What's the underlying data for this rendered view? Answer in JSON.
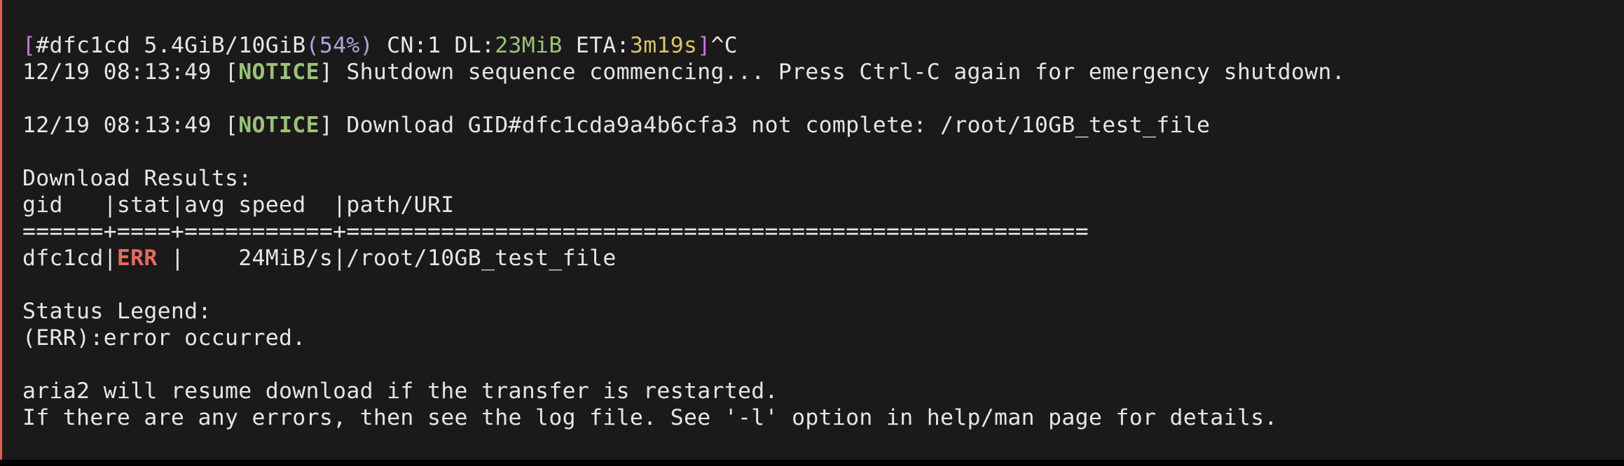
{
  "progress": {
    "open": "[",
    "gid_progress": "#dfc1cd 5.4GiB/10GiB",
    "percent": "(54%)",
    "cn": " CN:1 DL:",
    "dl": "23MiB",
    "eta_label": " ETA:",
    "eta": "3m19s",
    "close": "]",
    "interrupt": "^C"
  },
  "notice1": {
    "timestamp": "12/19 08:13:49 ",
    "open": "[",
    "tag": "NOTICE",
    "close": "]",
    "message": " Shutdown sequence commencing... Press Ctrl-C again for emergency shutdown."
  },
  "notice2": {
    "timestamp": "12/19 08:13:49 ",
    "open": "[",
    "tag": "NOTICE",
    "close": "]",
    "message": " Download GID#dfc1cda9a4b6cfa3 not complete: /root/10GB_test_file"
  },
  "results": {
    "title": "Download Results:",
    "header": "gid   |stat|avg speed  |path/URI",
    "separator": "======+====+===========+=======================================================",
    "row": {
      "gid": "dfc1cd|",
      "stat": "ERR",
      "rest": " |    24MiB/s|/root/10GB_test_file"
    }
  },
  "legend": {
    "title": "Status Legend:",
    "err": "(ERR):error occurred."
  },
  "footer": {
    "resume": "aria2 will resume download if the transfer is restarted.",
    "errors": "If there are any errors, then see the log file. See '-l' option in help/man page for details."
  },
  "colors": {
    "background": "#1c191a",
    "left_border": "#e25b57",
    "text": "#e6e6e6",
    "notice": "#98c379",
    "err": "#e06c60",
    "bracket": "#c678dd",
    "eta": "#d7c46a",
    "percent": "#a9a6e0"
  }
}
